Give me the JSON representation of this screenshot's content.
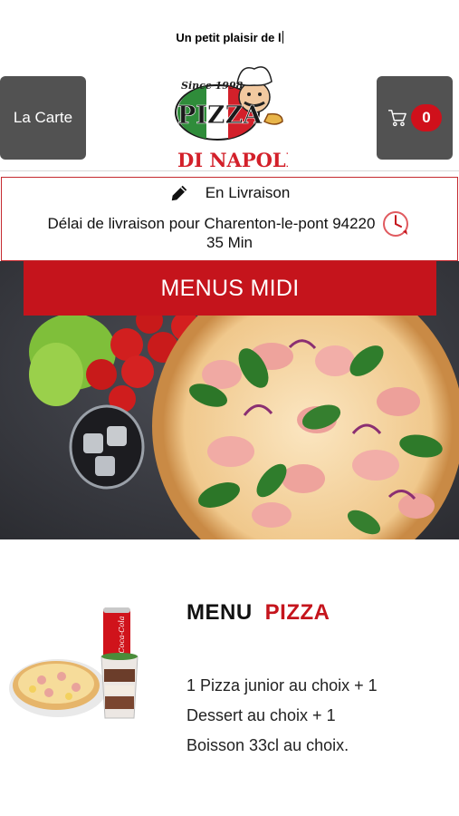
{
  "ticker": {
    "text": "Un petit plaisir de l"
  },
  "header": {
    "menu_button_label": "La Carte",
    "cart_count": "0",
    "logo": {
      "since": "Since 1998",
      "brand": "PIZZA",
      "sub": "DI NAPOLI"
    }
  },
  "delivery": {
    "mode": "En Livraison",
    "info": "Délai de livraison pour Charenton-le-pont 94220",
    "time": "35 Min"
  },
  "hero": {
    "banner": "MENUS MIDI",
    "can_text": "Coca-Cola"
  },
  "menu_card": {
    "title_part1": "MENU",
    "title_part2": "PIZZA",
    "description": "1 Pizza junior au choix + 1 Dessert au choix + 1 Boisson 33cl au choix."
  },
  "colors": {
    "brand_red": "#c5141c",
    "button_grey": "#525252",
    "badge_red": "#d0101b"
  }
}
